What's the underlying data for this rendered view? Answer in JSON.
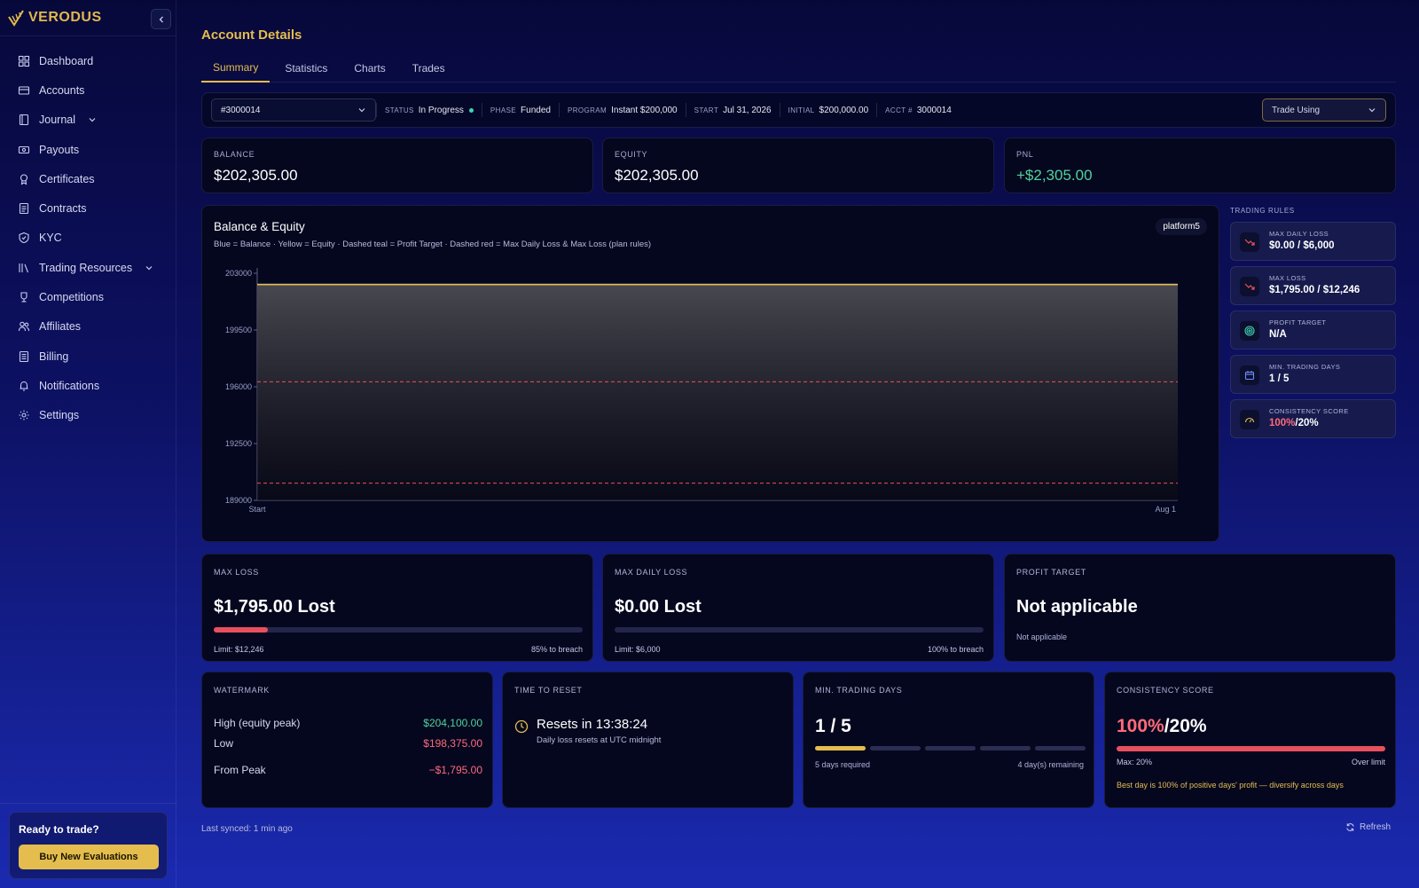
{
  "brand": {
    "name": "VERODUS",
    "accent": "#e4bd4e"
  },
  "sidebar": {
    "items": [
      {
        "label": "Dashboard",
        "icon": "grid-icon"
      },
      {
        "label": "Accounts",
        "icon": "card-icon"
      },
      {
        "label": "Journal",
        "icon": "book-icon",
        "expandable": true
      },
      {
        "label": "Payouts",
        "icon": "cash-icon"
      },
      {
        "label": "Certificates",
        "icon": "award-icon"
      },
      {
        "label": "Contracts",
        "icon": "document-icon"
      },
      {
        "label": "KYC",
        "icon": "shield-icon"
      },
      {
        "label": "Trading Resources",
        "icon": "library-icon",
        "expandable": true
      },
      {
        "label": "Competitions",
        "icon": "trophy-icon"
      },
      {
        "label": "Affiliates",
        "icon": "users-icon"
      },
      {
        "label": "Billing",
        "icon": "receipt-icon"
      },
      {
        "label": "Notifications",
        "icon": "bell-icon"
      },
      {
        "label": "Settings",
        "icon": "gear-icon"
      }
    ],
    "cta": {
      "title": "Ready to trade?",
      "button": "Buy New Evaluations"
    }
  },
  "page": {
    "title": "Account Details"
  },
  "tabs": [
    {
      "label": "Summary",
      "active": true
    },
    {
      "label": "Statistics"
    },
    {
      "label": "Charts"
    },
    {
      "label": "Trades"
    }
  ],
  "infobar": {
    "account_select": "#3000014",
    "status_label": "STATUS",
    "status": "In Progress",
    "phase_label": "PHASE",
    "phase": "Funded",
    "program_label": "PROGRAM",
    "program": "Instant $200,000",
    "start_label": "START",
    "start": "Jul 31, 2026",
    "initial_label": "INITIAL",
    "initial": "$200,000.00",
    "acct_label": "ACCT #",
    "acct": "3000014",
    "trade_using": "Trade Using"
  },
  "stats": {
    "balance": {
      "label": "BALANCE",
      "value": "$202,305.00"
    },
    "equity": {
      "label": "EQUITY",
      "value": "$202,305.00"
    },
    "pnl": {
      "label": "PNL",
      "value": "+$2,305.00",
      "color": "#4fd39a"
    }
  },
  "chart_header": {
    "title": "Balance & Equity",
    "subtitle": "Blue = Balance · Yellow = Equity · Dashed teal = Profit Target · Dashed red = Max Daily Loss & Max Loss (plan rules)",
    "badge": "platform5"
  },
  "chart_data": {
    "type": "line",
    "x": [
      "Start",
      "Aug 1"
    ],
    "y_ticks": [
      203000,
      199500,
      196000,
      192500,
      189000
    ],
    "ylim": [
      189000,
      203000
    ],
    "series": [
      {
        "name": "Balance",
        "values": [
          202305,
          202305
        ],
        "color": "#4a6cff"
      },
      {
        "name": "Equity",
        "values": [
          202305,
          202305
        ],
        "color": "#e4bd4e"
      }
    ],
    "reference_lines": [
      {
        "name": "Max Daily Loss",
        "value": 196305,
        "color": "#e8505e",
        "style": "dashed"
      },
      {
        "name": "Max Loss",
        "value": 190059,
        "color": "#e8505e",
        "style": "dashed"
      }
    ],
    "grid": false
  },
  "trading_rules": {
    "label": "TRADING RULES",
    "items": [
      {
        "label": "MAX DAILY LOSS",
        "value": "$0.00 / $6,000",
        "icon": "trend-down-icon",
        "icon_color": "#e8505e"
      },
      {
        "label": "MAX LOSS",
        "value": "$1,795.00 / $12,246",
        "icon": "trend-down-icon",
        "icon_color": "#e8505e"
      },
      {
        "label": "PROFIT TARGET",
        "value": "N/A",
        "icon": "target-icon",
        "icon_color": "#3fd3b4"
      },
      {
        "label": "MIN. TRADING DAYS",
        "value": "1 / 5",
        "icon": "calendar-icon",
        "icon_color": "#6b8cff"
      },
      {
        "label": "CONSISTENCY SCORE",
        "value_red": "100%",
        "value_rest": "/20%",
        "icon": "gauge-icon",
        "icon_color": "#e4bd4e"
      }
    ]
  },
  "max_loss_card": {
    "label": "MAX LOSS",
    "value": "$1,795.00 Lost",
    "progress": 0.146,
    "limit": "Limit: $12,246",
    "to_breach": "85% to breach"
  },
  "max_daily_card": {
    "label": "MAX DAILY LOSS",
    "value": "$0.00 Lost",
    "progress": 0,
    "limit": "Limit: $6,000",
    "to_breach": "100% to breach"
  },
  "profit_target_card": {
    "label": "PROFIT TARGET",
    "value": "Not applicable",
    "note": "Not applicable"
  },
  "watermark": {
    "label": "WATERMARK",
    "rows": [
      {
        "label": "High (equity peak)",
        "value": "$204,100.00",
        "color": "#4fd39a"
      },
      {
        "label": "Low",
        "value": "$198,375.00",
        "color": "#ff6b7a"
      },
      {
        "label": "From Peak",
        "value": "−$1,795.00",
        "color": "#ff6b7a"
      }
    ]
  },
  "reset": {
    "label": "TIME TO RESET",
    "value": "Resets in 13:38:24",
    "note": "Daily loss resets at UTC midnight"
  },
  "min_days": {
    "label": "MIN. TRADING DAYS",
    "value": "1 / 5",
    "done": 1,
    "total": 5,
    "required": "5 days required",
    "remaining": "4 day(s) remaining"
  },
  "consistency": {
    "label": "CONSISTENCY SCORE",
    "value_red": "100%",
    "value_rest": "/20%",
    "max": "Max: 20%",
    "status": "Over limit",
    "warning": "Best day is 100% of positive days' profit — diversify across days"
  },
  "footer": {
    "synced": "Last synced: 1 min ago",
    "refresh": "Refresh"
  }
}
